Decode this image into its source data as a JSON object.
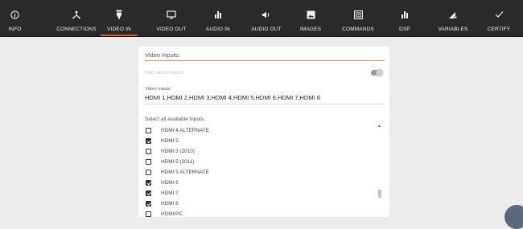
{
  "nav": {
    "tabs": [
      {
        "label": "INFO",
        "icon": "info-icon",
        "active": false
      },
      {
        "label": "CONNECTIONS",
        "icon": "connections-icon",
        "active": false
      },
      {
        "label": "VIDEO IN",
        "icon": "video-in-icon",
        "active": true
      },
      {
        "label": "VIDEO OUT",
        "icon": "monitor-icon",
        "active": false
      },
      {
        "label": "AUDIO IN",
        "icon": "bar-chart-icon",
        "active": false
      },
      {
        "label": "AUDIO OUT",
        "icon": "speaker-icon",
        "active": false
      },
      {
        "label": "IMAGES",
        "icon": "image-icon",
        "active": false
      },
      {
        "label": "COMMANDS",
        "icon": "commands-icon",
        "active": false
      },
      {
        "label": "DSP",
        "icon": "bar-chart-icon",
        "active": false
      },
      {
        "label": "VARIABLES",
        "icon": "variables-icon",
        "active": false
      },
      {
        "label": "CERTIFY",
        "icon": "check-icon",
        "active": false
      }
    ]
  },
  "form": {
    "section_title": "Video Inputs:",
    "has_video_inputs_label": "Has video inputs",
    "video_inputs_label": "Video inputs",
    "video_inputs_value": "HDMI 1,HDMI 2,HDMI 3,HDMI 4,HDMI 5,HDMI 6,HDMI 7,HDMI 8",
    "select_label": "Select all available inputs:",
    "items": [
      {
        "label": "HDMI 4 ALTERNATE",
        "checked": false
      },
      {
        "label": "HDMI 5",
        "checked": true
      },
      {
        "label": "HDMI 5 (2010)",
        "checked": false
      },
      {
        "label": "HDMI 5 (2011)",
        "checked": false
      },
      {
        "label": "HDMI 5 ALTERNATE",
        "checked": false
      },
      {
        "label": "HDMI 6",
        "checked": true
      },
      {
        "label": "HDMI 7",
        "checked": true
      },
      {
        "label": "HDMI 8",
        "checked": true
      },
      {
        "label": "HDMI/PC",
        "checked": false
      }
    ]
  },
  "colors": {
    "topbar": "#2a2a2a",
    "accent": "#e0591b",
    "background": "#ececec"
  }
}
